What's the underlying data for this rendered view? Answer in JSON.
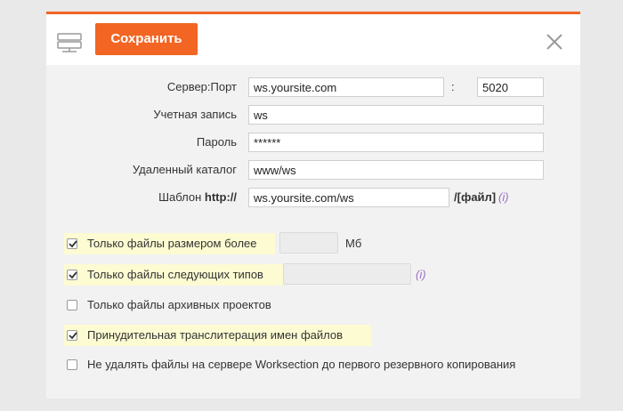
{
  "toolbar": {
    "icon": "server-icon",
    "save_label": "Сохранить",
    "close_icon": "close-icon"
  },
  "colors": {
    "accent": "#f26522",
    "highlight": "#fdfbd2",
    "info": "#9b6fc0"
  },
  "form": {
    "server": {
      "label": "Сервер:Порт",
      "value": "ws.yoursite.com",
      "colon": ":",
      "port": "5020"
    },
    "account": {
      "label": "Учетная запись",
      "value": "ws"
    },
    "password": {
      "label": "Пароль",
      "value": "******"
    },
    "directory": {
      "label": "Удаленный каталог",
      "value": "www/ws"
    },
    "template": {
      "label_prefix": "Шаблон ",
      "label_bold": "http://",
      "value": "ws.yoursite.com/ws",
      "suffix": "/[файл]",
      "info": "(i)"
    }
  },
  "options": [
    {
      "label": "Только файлы размером более",
      "checked": true,
      "highlighted": true,
      "unit": "Мб"
    },
    {
      "label": "Только файлы следующих типов",
      "checked": true,
      "highlighted": true,
      "info": "(i)"
    },
    {
      "label": "Только файлы архивных проектов",
      "checked": false,
      "highlighted": false
    },
    {
      "label": "Принудительная транслитерация имен файлов",
      "checked": true,
      "highlighted": true
    },
    {
      "label": "Не удалять файлы на сервере Worksection до первого резервного копирования",
      "checked": false,
      "highlighted": false
    }
  ]
}
